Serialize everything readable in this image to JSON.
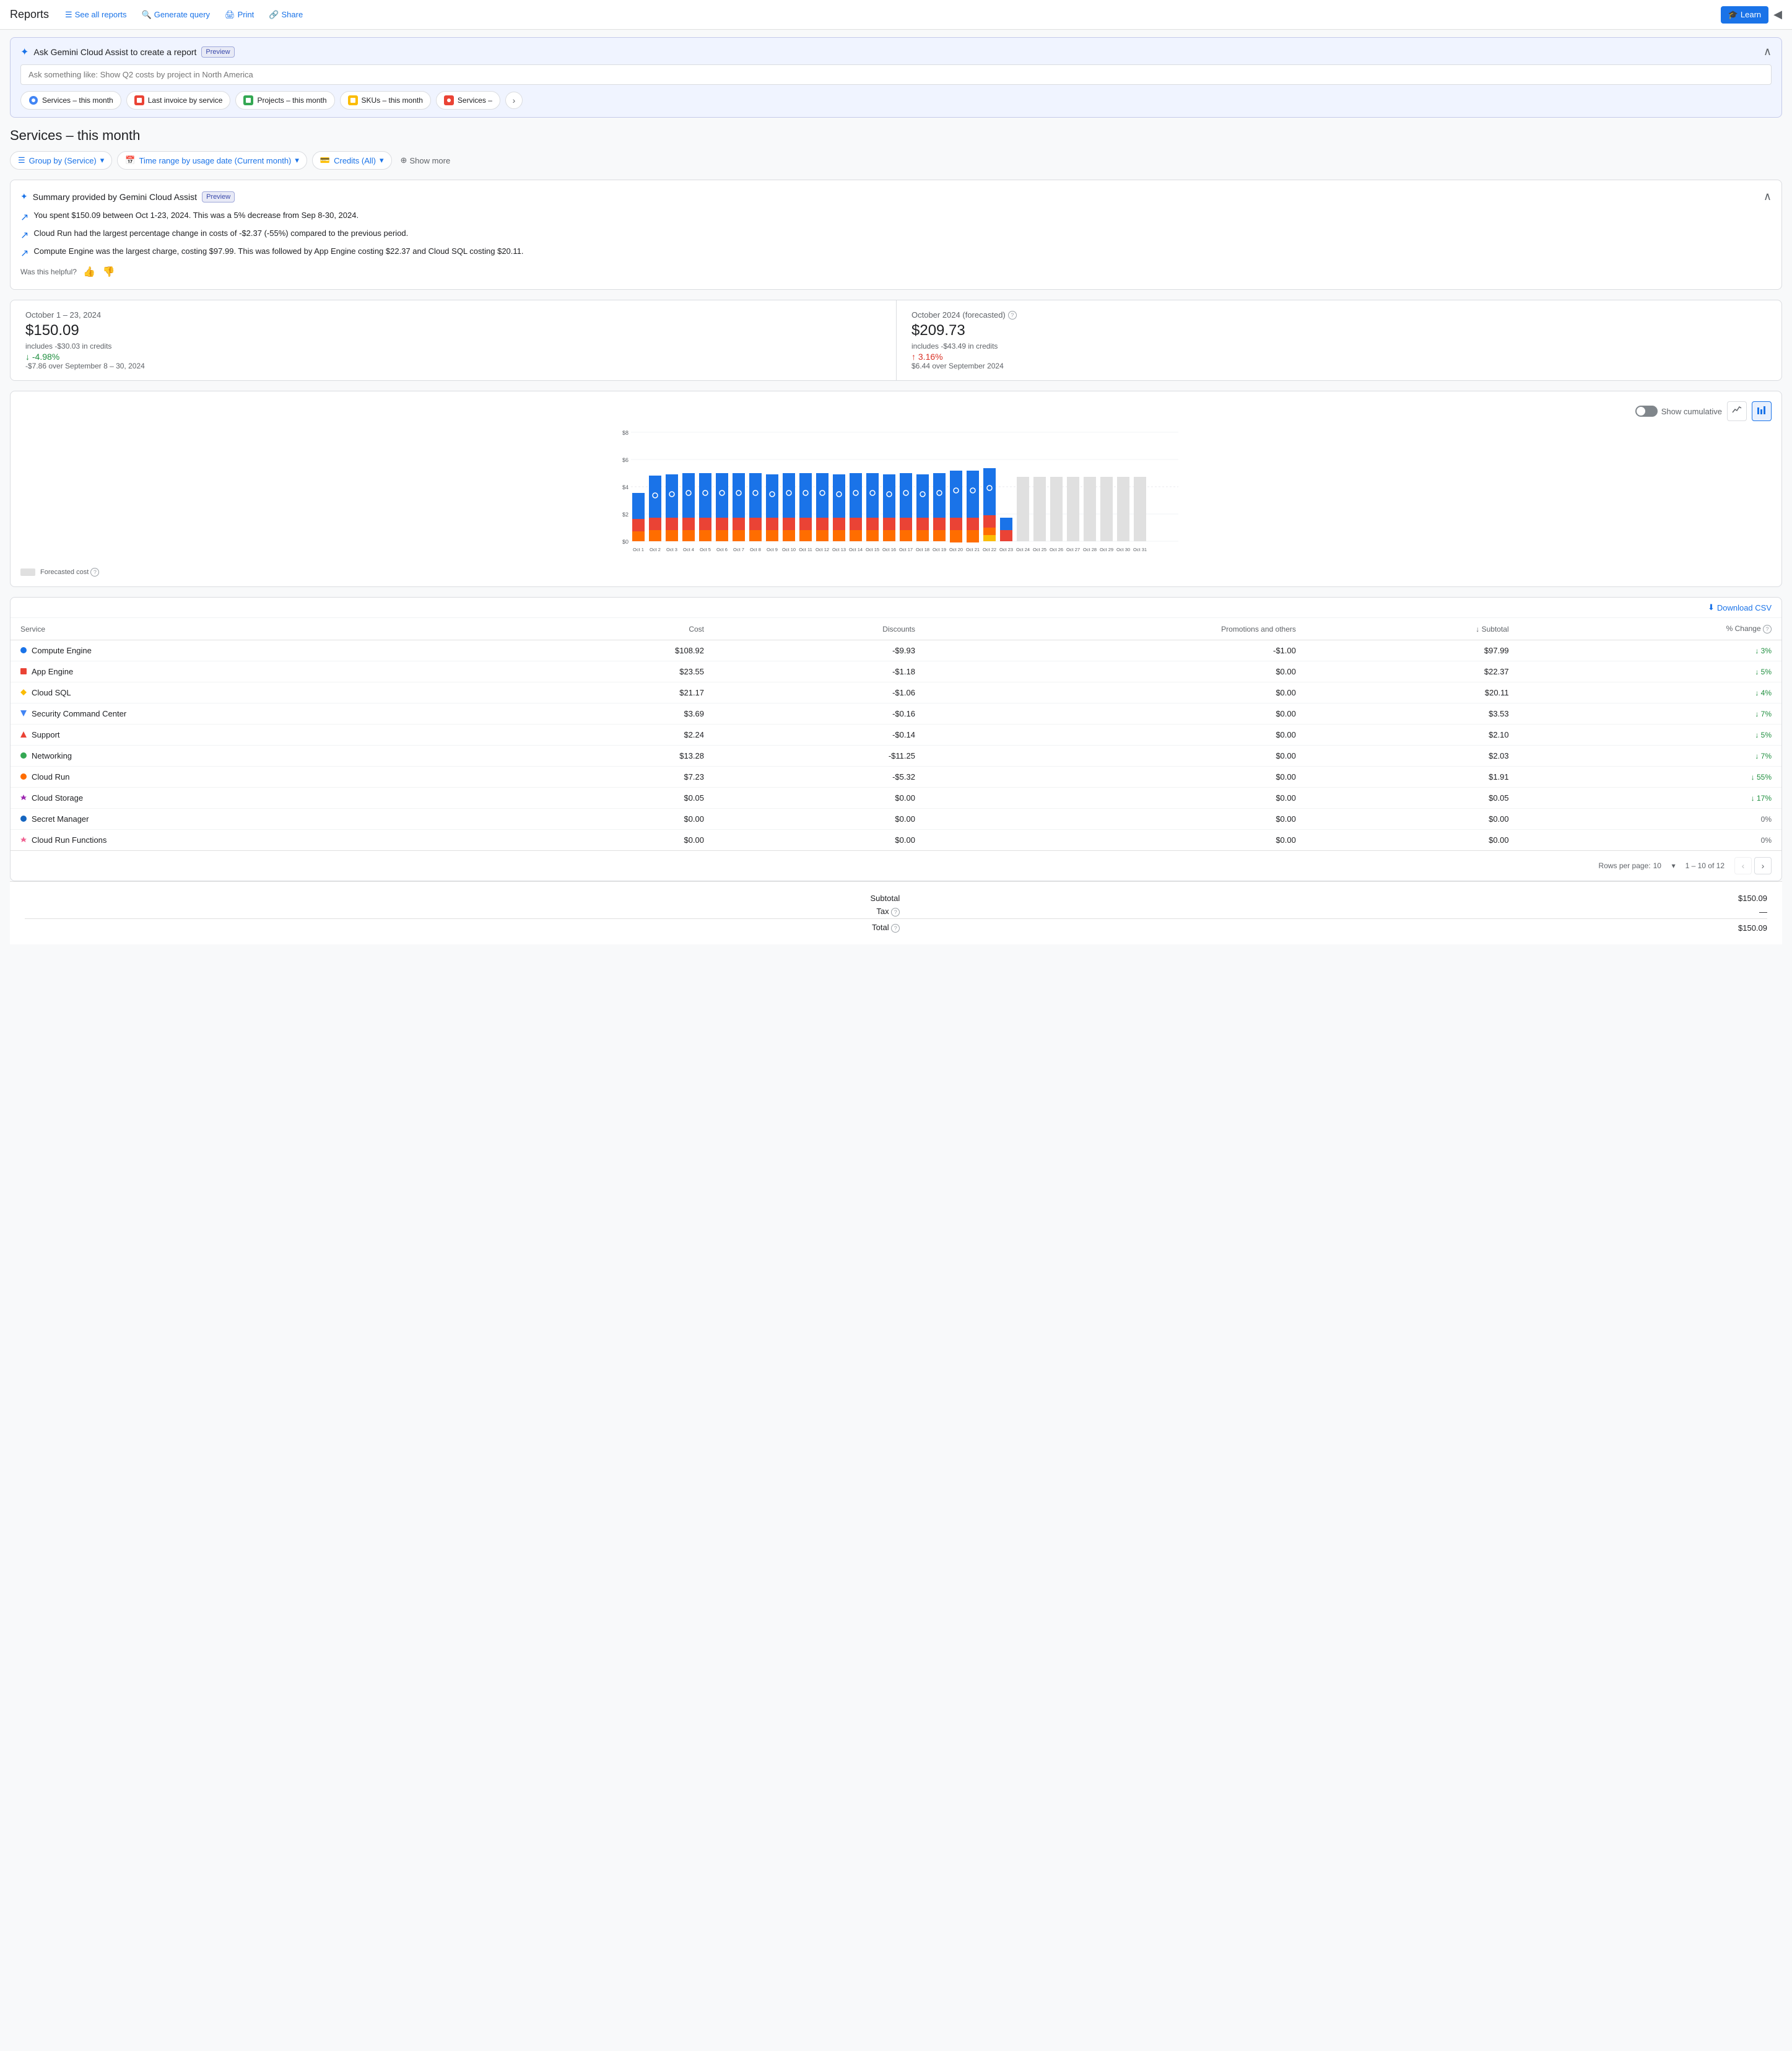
{
  "header": {
    "title": "Reports",
    "actions": [
      {
        "label": "See all reports",
        "icon": "list-icon"
      },
      {
        "label": "Generate query",
        "icon": "search-icon"
      },
      {
        "label": "Print",
        "icon": "print-icon"
      },
      {
        "label": "Share",
        "icon": "share-icon"
      }
    ],
    "learn_label": "Learn",
    "collapse_icon": "collapse-icon"
  },
  "gemini": {
    "title": "Ask Gemini Cloud Assist to create a report",
    "badge": "Preview",
    "placeholder": "Ask something like: Show Q2 costs by project in North America",
    "chips": [
      {
        "label": "Services – this month"
      },
      {
        "label": "Last invoice by service"
      },
      {
        "label": "Projects – this month"
      },
      {
        "label": "SKUs – this month"
      },
      {
        "label": "Services –"
      }
    ],
    "next_icon": "chevron-right-icon"
  },
  "page_title": "Services – this month",
  "filters": [
    {
      "label": "Group by (Service)",
      "icon": "table-icon"
    },
    {
      "label": "Time range by usage date (Current month)",
      "icon": "calendar-icon"
    },
    {
      "label": "Credits (All)",
      "icon": "credit-icon"
    }
  ],
  "show_more_label": "Show more",
  "summary": {
    "title": "Summary provided by Gemini Cloud Assist",
    "badge": "Preview",
    "items": [
      "You spent $150.09 between Oct 1-23, 2024. This was a 5% decrease from Sep 8-30, 2024.",
      "Cloud Run had the largest percentage change in costs of -$2.37 (-55%) compared to the previous period.",
      "Compute Engine was the largest charge, costing $97.99. This was followed by App Engine costing $22.37 and Cloud SQL costing $20.11."
    ],
    "helpful_label": "Was this helpful?"
  },
  "metrics": {
    "current": {
      "label": "October 1 – 23, 2024",
      "value": "$150.09",
      "credits": "includes -$30.03 in credits",
      "change": "-4.98%",
      "change_direction": "down",
      "change_sub": "-$7.86 over September 8 – 30, 2024"
    },
    "forecasted": {
      "label": "October 2024 (forecasted)",
      "value": "$209.73",
      "credits": "includes -$43.49 in credits",
      "change": "3.16%",
      "change_direction": "up",
      "change_sub": "$6.44 over September 2024"
    }
  },
  "chart": {
    "show_cumulative_label": "Show cumulative",
    "y_labels": [
      "$8",
      "$6",
      "$4",
      "$2",
      "$0"
    ],
    "x_labels": [
      "Oct 1",
      "Oct 2",
      "Oct 3",
      "Oct 4",
      "Oct 5",
      "Oct 6",
      "Oct 7",
      "Oct 8",
      "Oct 9",
      "Oct 10",
      "Oct 11",
      "Oct 12",
      "Oct 13",
      "Oct 14",
      "Oct 15",
      "Oct 16",
      "Oct 17",
      "Oct 18",
      "Oct 19",
      "Oct 20",
      "Oct 21",
      "Oct 22",
      "Oct 23",
      "Oct 24",
      "Oct 25",
      "Oct 26",
      "Oct 27",
      "Oct 28",
      "Oct 29",
      "Oct 30",
      "Oct 31"
    ],
    "forecasted_label": "Forecasted cost"
  },
  "table": {
    "download_label": "Download CSV",
    "headers": [
      "Service",
      "Cost",
      "Discounts",
      "Promotions and others",
      "Subtotal",
      "% Change"
    ],
    "rows": [
      {
        "service": "Compute Engine",
        "color": "#1a73e8",
        "shape": "circle",
        "cost": "$108.92",
        "discounts": "-$9.93",
        "promos": "-$1.00",
        "subtotal": "$97.99",
        "pct": "↓ 3%",
        "pct_dir": "down"
      },
      {
        "service": "App Engine",
        "color": "#ea4335",
        "shape": "square",
        "cost": "$23.55",
        "discounts": "-$1.18",
        "promos": "$0.00",
        "subtotal": "$22.37",
        "pct": "↓ 5%",
        "pct_dir": "down"
      },
      {
        "service": "Cloud SQL",
        "color": "#fbbc04",
        "shape": "diamond",
        "cost": "$21.17",
        "discounts": "-$1.06",
        "promos": "$0.00",
        "subtotal": "$20.11",
        "pct": "↓ 4%",
        "pct_dir": "down"
      },
      {
        "service": "Security Command Center",
        "color": "#4285f4",
        "shape": "triangle-down",
        "cost": "$3.69",
        "discounts": "-$0.16",
        "promos": "$0.00",
        "subtotal": "$3.53",
        "pct": "↓ 7%",
        "pct_dir": "down"
      },
      {
        "service": "Support",
        "color": "#ea4335",
        "shape": "triangle-up",
        "cost": "$2.24",
        "discounts": "-$0.14",
        "promos": "$0.00",
        "subtotal": "$2.10",
        "pct": "↓ 5%",
        "pct_dir": "down"
      },
      {
        "service": "Networking",
        "color": "#34a853",
        "shape": "circle",
        "cost": "$13.28",
        "discounts": "-$11.25",
        "promos": "$0.00",
        "subtotal": "$2.03",
        "pct": "↓ 7%",
        "pct_dir": "down"
      },
      {
        "service": "Cloud Run",
        "color": "#ff6d00",
        "shape": "circle",
        "cost": "$7.23",
        "discounts": "-$5.32",
        "promos": "$0.00",
        "subtotal": "$1.91",
        "pct": "↓ 55%",
        "pct_dir": "down"
      },
      {
        "service": "Cloud Storage",
        "color": "#9c27b0",
        "shape": "star",
        "cost": "$0.05",
        "discounts": "$0.00",
        "promos": "$0.00",
        "subtotal": "$0.05",
        "pct": "↓ 17%",
        "pct_dir": "down"
      },
      {
        "service": "Secret Manager",
        "color": "#1565c0",
        "shape": "circle",
        "cost": "$0.00",
        "discounts": "$0.00",
        "promos": "$0.00",
        "subtotal": "$0.00",
        "pct": "0%",
        "pct_dir": "zero"
      },
      {
        "service": "Cloud Run Functions",
        "color": "#f06292",
        "shape": "star",
        "cost": "$0.00",
        "discounts": "$0.00",
        "promos": "$0.00",
        "subtotal": "$0.00",
        "pct": "0%",
        "pct_dir": "zero"
      }
    ],
    "pagination": {
      "rows_per_page_label": "Rows per page:",
      "rows_per_page_value": "10",
      "range_label": "1 – 10 of 12"
    },
    "totals": {
      "subtotal_label": "Subtotal",
      "subtotal_value": "$150.09",
      "tax_label": "Tax",
      "tax_value": "—",
      "total_label": "Total",
      "total_value": "$150.09"
    }
  }
}
